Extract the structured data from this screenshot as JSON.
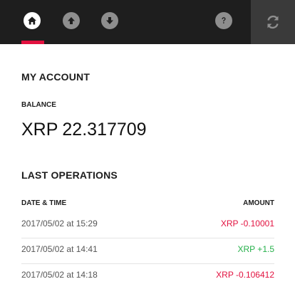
{
  "nav": {
    "items": [
      {
        "icon": "home-icon",
        "active": true
      },
      {
        "icon": "upload-icon",
        "active": false
      },
      {
        "icon": "download-icon",
        "active": false
      },
      {
        "icon": "help-icon",
        "active": false
      }
    ],
    "refresh_icon": "refresh-icon"
  },
  "colors": {
    "accent": "#e2113f",
    "topbar": "#1e1e1e",
    "positive": "#25b04a",
    "negative": "#e2113f"
  },
  "account": {
    "title": "MY ACCOUNT",
    "balance_label": "BALANCE",
    "currency": "XRP",
    "balance": "22.317709"
  },
  "operations": {
    "title": "LAST OPERATIONS",
    "col_datetime": "DATE & TIME",
    "col_amount": "AMOUNT",
    "rows": [
      {
        "datetime": "2017/05/02 at 15:29",
        "amount": "XRP -0.10001",
        "sign": "negative"
      },
      {
        "datetime": "2017/05/02 at 14:41",
        "amount": "XRP +1.5",
        "sign": "positive"
      },
      {
        "datetime": "2017/05/02 at 14:18",
        "amount": "XRP -0.106412",
        "sign": "negative"
      }
    ]
  }
}
